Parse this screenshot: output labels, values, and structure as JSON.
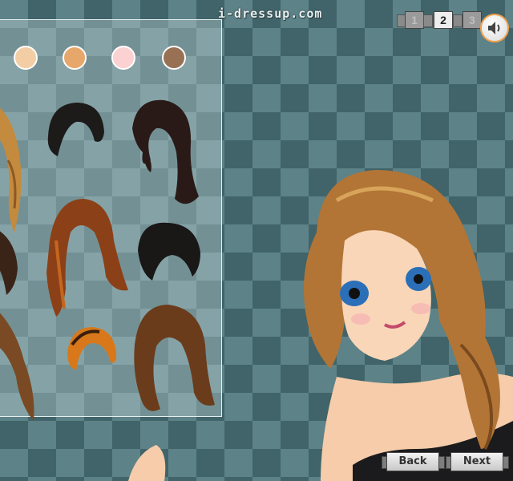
{
  "site_logo": "i-dressup.com",
  "pager": {
    "pages": [
      "1",
      "2",
      "3"
    ],
    "current": "2"
  },
  "skin_tones": [
    "#f3cda4",
    "#e7a66a",
    "#fbd1d1",
    "#987155"
  ],
  "nav": {
    "back_label": "Back",
    "next_label": "Next"
  },
  "icons": {
    "sound": "speaker-icon"
  }
}
